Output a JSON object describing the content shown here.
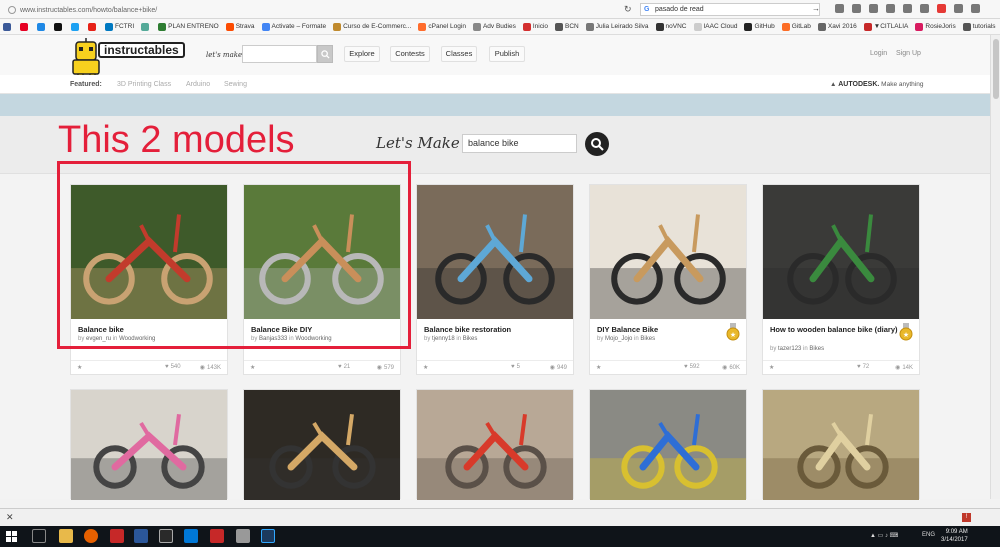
{
  "browser": {
    "url": "www.instructables.com/howto/balance+bike/",
    "search_value": "pasado de read"
  },
  "bookmarks": [
    {
      "label": "",
      "color": "#3b5998"
    },
    {
      "label": "",
      "color": "#e60023"
    },
    {
      "label": "",
      "color": "#1e88e5"
    },
    {
      "label": "",
      "color": "#111111"
    },
    {
      "label": "",
      "color": "#1da1f2"
    },
    {
      "label": "",
      "color": "#e62117"
    },
    {
      "label": "FCTRI",
      "color": "#0079c1"
    },
    {
      "label": "",
      "color": "#5a9"
    },
    {
      "label": "PLAN ENTRENO",
      "color": "#2e7d32"
    },
    {
      "label": "Strava",
      "color": "#fc4c02"
    },
    {
      "label": "Activate – Formate",
      "color": "#4285f4"
    },
    {
      "label": "Curso de E-Commerc...",
      "color": "#c08a2d"
    },
    {
      "label": "cPanel Login",
      "color": "#ff6c2c"
    },
    {
      "label": "Adv Budies",
      "color": "#888"
    },
    {
      "label": "Inicio",
      "color": "#d32f2f"
    },
    {
      "label": "BCN",
      "color": "#555"
    },
    {
      "label": "Julia Leirado Silva",
      "color": "#777"
    },
    {
      "label": "noVNC",
      "color": "#333"
    },
    {
      "label": "IAAC Cloud",
      "color": "#ccc"
    },
    {
      "label": "GitHub",
      "color": "#222"
    },
    {
      "label": "GitLab",
      "color": "#fc6d26"
    },
    {
      "label": "Xavi 2016",
      "color": "#666"
    },
    {
      "label": "▼CITLALIA",
      "color": "#c62828"
    },
    {
      "label": "RosieJoris",
      "color": "#d81b60"
    },
    {
      "label": "tutorials",
      "color": "#555"
    }
  ],
  "site": {
    "brand": "instructables",
    "lets_make": "let's make",
    "nav": [
      "Explore",
      "Contests",
      "Classes",
      "Publish"
    ],
    "login": "Login",
    "signup": "Sign Up",
    "featured_label": "Featured:",
    "featured_links": [
      "3D Printing Class",
      "Arduino",
      "Sewing"
    ],
    "autodesk_brand": "AUTODESK.",
    "autodesk_tagline": "Make anything"
  },
  "hero": {
    "lets_make": "Let's Make",
    "search_value": "balance bike"
  },
  "annotation": "This 2 models",
  "results_row1": [
    {
      "title": "Balance bike",
      "by": "by",
      "author": "evgen_ru",
      "in": "in",
      "category": "Woodworking",
      "favorites": "540",
      "views": "143K",
      "badge": false,
      "palette": [
        "#3e5a2a",
        "#c23b2c",
        "#c9a272"
      ]
    },
    {
      "title": "Balance Bike DIY",
      "by": "by",
      "author": "Banjas333",
      "in": "in",
      "category": "Woodworking",
      "favorites": "21",
      "views": "579",
      "badge": false,
      "palette": [
        "#5a7a3a",
        "#c98f5a",
        "#b8b8b8"
      ]
    },
    {
      "title": "Balance bike restoration",
      "by": "by",
      "author": "tjenny18",
      "in": "in",
      "category": "Bikes",
      "favorites": "5",
      "views": "949",
      "badge": false,
      "palette": [
        "#7a6b5a",
        "#5ea8d6",
        "#2a2a2a"
      ]
    },
    {
      "title": "DIY Balance Bike",
      "by": "by",
      "author": "Mojo_Jojo",
      "in": "in",
      "category": "Bikes",
      "favorites": "592",
      "views": "60K",
      "badge": true,
      "palette": [
        "#e8e2d8",
        "#c89a5e",
        "#2a2a2a"
      ]
    },
    {
      "title": "How to wooden balance bike (diary)",
      "by": "by",
      "author": "tazer123",
      "in": "in",
      "category": "Bikes",
      "favorites": "72",
      "views": "14K",
      "badge": true,
      "palette": [
        "#3a3a38",
        "#3a8a3e",
        "#2a2a2a"
      ]
    }
  ],
  "results_row2": [
    {
      "palette": [
        "#d8d4cc",
        "#e06aa0",
        "#444"
      ]
    },
    {
      "palette": [
        "#2e2a24",
        "#d4a866",
        "#333"
      ]
    },
    {
      "palette": [
        "#b8a896",
        "#d83a2a",
        "#5a5048"
      ]
    },
    {
      "palette": [
        "#8a8a84",
        "#2e6ed6",
        "#d8c030"
      ]
    },
    {
      "palette": [
        "#b8a880",
        "#e0d0a0",
        "#6a5a3a"
      ]
    }
  ],
  "taskbar": {
    "lang": "ENG",
    "time": "9:09 AM",
    "date": "3/14/2017"
  }
}
